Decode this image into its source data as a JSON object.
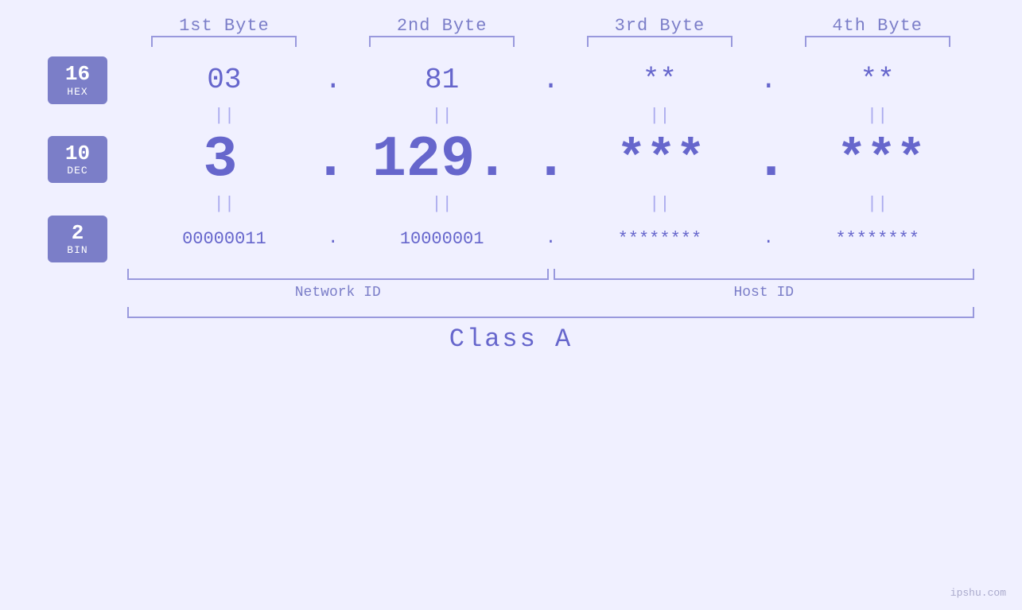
{
  "header": {
    "byte1": "1st Byte",
    "byte2": "2nd Byte",
    "byte3": "3rd Byte",
    "byte4": "4th Byte"
  },
  "bases": {
    "hex": {
      "num": "16",
      "label": "HEX"
    },
    "dec": {
      "num": "10",
      "label": "DEC"
    },
    "bin": {
      "num": "2",
      "label": "BIN"
    }
  },
  "hex_row": {
    "b1": "03",
    "b2": "81",
    "b3": "**",
    "b4": "**"
  },
  "dec_row": {
    "b1": "3",
    "b2": "129.",
    "b3": "***",
    "b4": "***"
  },
  "bin_row": {
    "b1": "00000011",
    "b2": "10000001",
    "b3": "********",
    "b4": "********"
  },
  "labels": {
    "network_id": "Network ID",
    "host_id": "Host ID",
    "class_a": "Class A"
  },
  "watermark": "ipshu.com"
}
